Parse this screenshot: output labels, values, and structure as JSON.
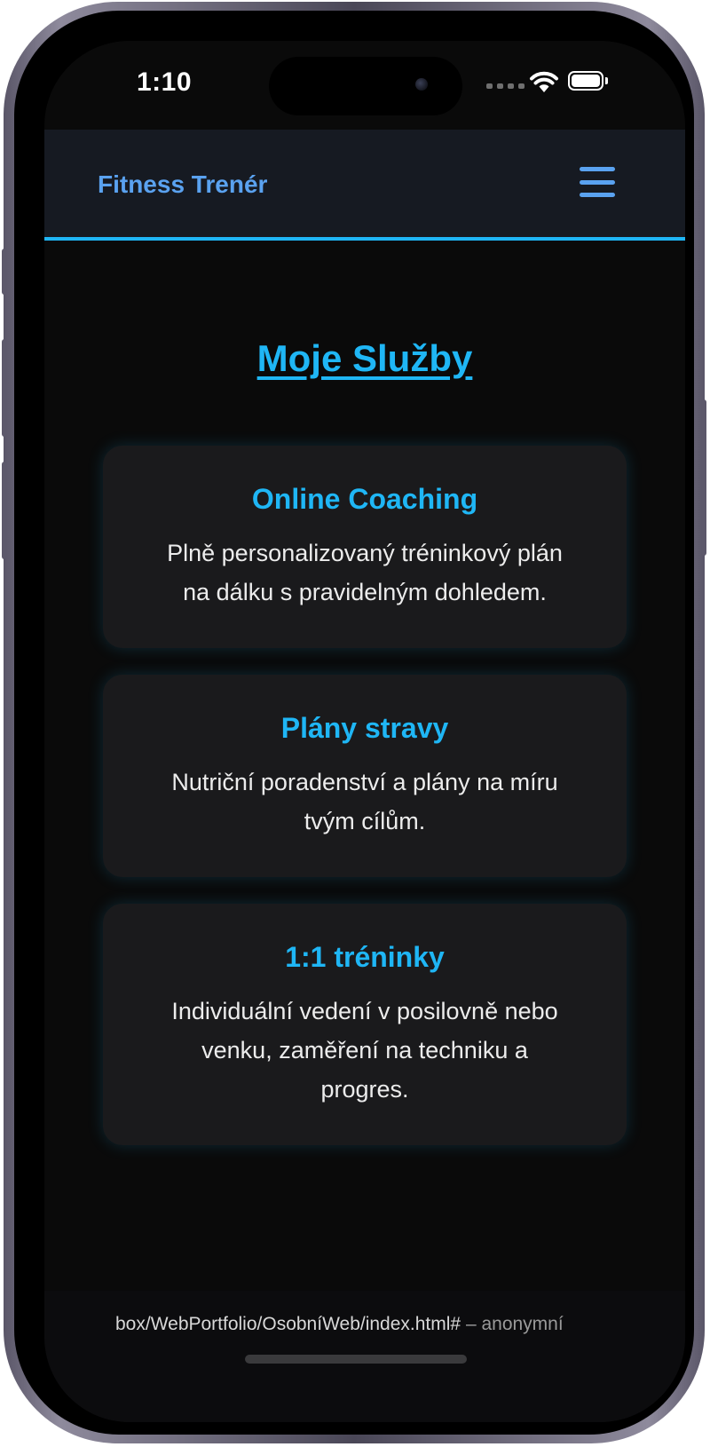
{
  "status_bar": {
    "time": "1:10"
  },
  "navbar": {
    "brand": "Fitness Trenér"
  },
  "page": {
    "title": "Moje Služby"
  },
  "services": [
    {
      "title": "Online Coaching",
      "line1": "Plně personalizovaný tréninkový plán",
      "line2": "na dálku s pravidelným dohledem."
    },
    {
      "title": "Plány stravy",
      "line1": "Nutriční poradenství a plány na míru",
      "line2": "tvým cílům."
    },
    {
      "title": "1:1 tréninky",
      "line1": "Individuální vedení v posilovně nebo",
      "line2": "venku, zaměření na techniku a",
      "line3": "progres."
    }
  ],
  "browser": {
    "url": "box/WebPortfolio/OsobníWeb/index.html#",
    "url_suffix": " – anonymní"
  },
  "colors": {
    "accent": "#1fb6f5",
    "brand": "#5aa2f0",
    "background": "#0a0a0a",
    "card": "#1a1a1c"
  }
}
